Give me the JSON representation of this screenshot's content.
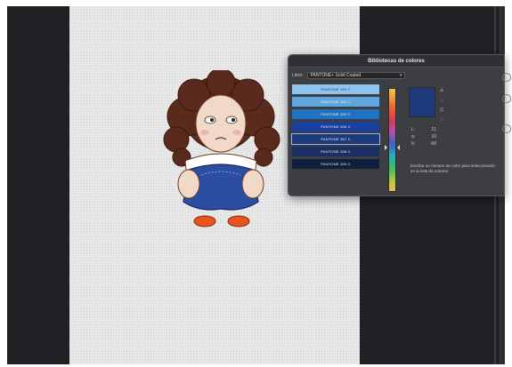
{
  "panel": {
    "title": "Bibliotecas de colores",
    "library_label": "Libro:",
    "library_value": "PANTONE+ Solid Coated",
    "swatches": [
      {
        "label": "PANTONE 283 C",
        "color": "#8fc4ef",
        "text_color": "#2a3b55"
      },
      {
        "label": "PANTONE 284 C",
        "color": "#5fa6df",
        "text_color": "#e9f2ff"
      },
      {
        "label": "PANTONE 285 C",
        "color": "#1f72c0",
        "text_color": "#e9f2ff"
      },
      {
        "label": "PANTONE 286 C",
        "color": "#1a3fa0",
        "text_color": "#e9f2ff"
      },
      {
        "label": "PANTONE 287 C",
        "color": "#1e3a7a",
        "text_color": "#e9f2ff"
      },
      {
        "label": "PANTONE 288 C",
        "color": "#1b2f63",
        "text_color": "#e9f2ff"
      },
      {
        "label": "PANTONE 289 C",
        "color": "#0f1f3e",
        "text_color": "#e9f2ff"
      }
    ],
    "selected_index": 4,
    "preview_color": "#1e3a7a",
    "lab": [
      {
        "key": "L:",
        "value": "21"
      },
      {
        "key": "a:",
        "value": "10"
      },
      {
        "key": "b:",
        "value": "-58"
      }
    ],
    "hint": "Escribe un número de color para seleccionarlo en la lista de colores."
  },
  "icons": {
    "warning": "gamut-warning-icon",
    "cube": "web-safe-icon"
  }
}
